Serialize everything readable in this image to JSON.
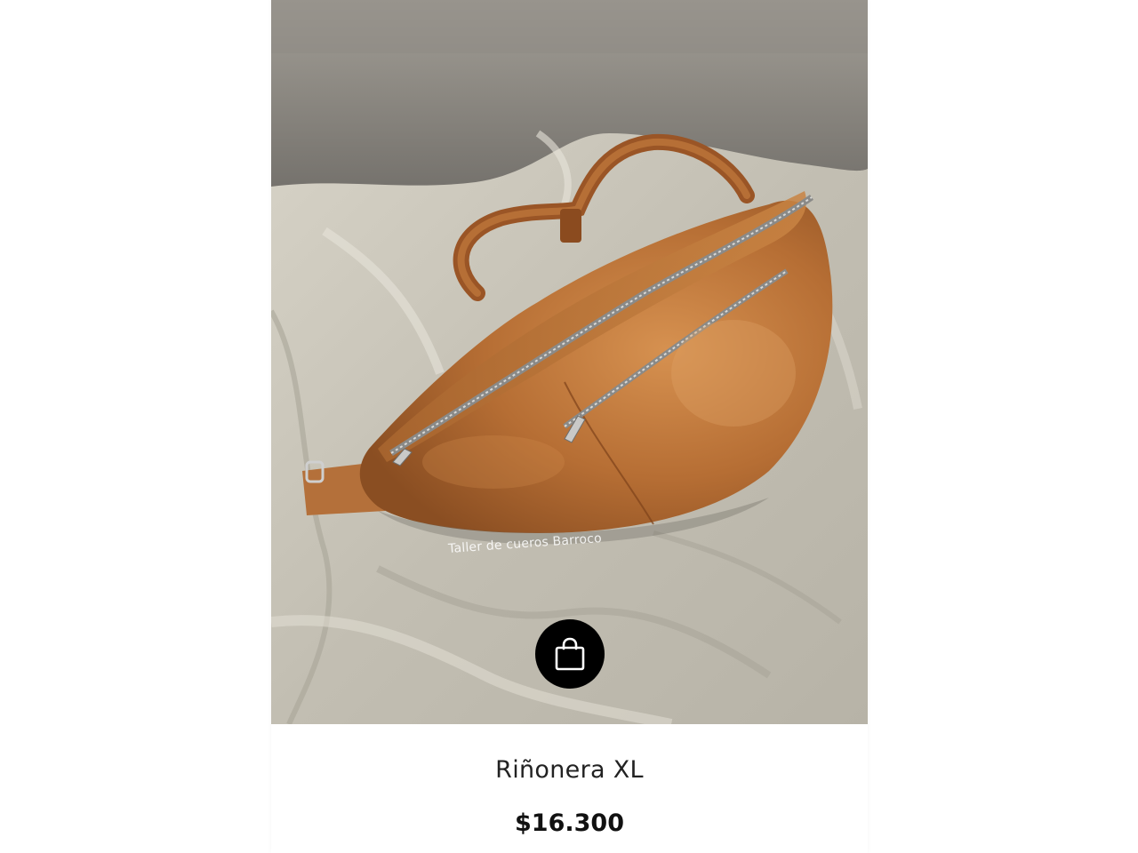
{
  "product": {
    "name": "Riñonera XL",
    "price": "$16.300",
    "image_watermark": "Taller de cueros Barroco",
    "image_subject": "leather belt bag on linen cloth"
  },
  "cart_button": {
    "icon": "shopping-bag-icon"
  },
  "colors": {
    "cart_button_bg": "#000000",
    "cart_icon": "#ffffff",
    "leather": "#b9733a",
    "cloth": "#c9c5ba",
    "wall": "#8f8c86"
  }
}
